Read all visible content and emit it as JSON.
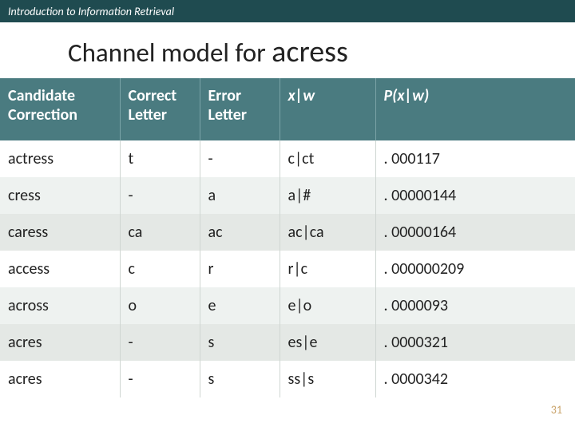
{
  "top_bar": "Introduction to Information Retrieval",
  "title_prefix": "Channel model for ",
  "title_word": "acress",
  "headers": {
    "candidate": "Candidate Correction",
    "correct": "Correct Letter",
    "error": "Error Letter",
    "xw": "x|w",
    "pxw": "P(x|w)"
  },
  "rows": [
    {
      "cand": "actress",
      "correct": "t",
      "error": "-",
      "xw": "c|ct",
      "pxw": ". 000117"
    },
    {
      "cand": "cress",
      "correct": "-",
      "error": "a",
      "xw": "a|#",
      "pxw": ". 00000144"
    },
    {
      "cand": "caress",
      "correct": "ca",
      "error": "ac",
      "xw": "ac|ca",
      "pxw": ". 00000164"
    },
    {
      "cand": "access",
      "correct": "c",
      "error": "r",
      "xw": "r|c",
      "pxw": ". 000000209"
    },
    {
      "cand": "across",
      "correct": "o",
      "error": "e",
      "xw": "e|o",
      "pxw": ". 0000093"
    },
    {
      "cand": "acres",
      "correct": "-",
      "error": "s",
      "xw": "es|e",
      "pxw": ". 0000321"
    },
    {
      "cand": "acres",
      "correct": "-",
      "error": "s",
      "xw": "ss|s",
      "pxw": ". 0000342"
    }
  ],
  "row_shades": [
    "white",
    "light",
    "gray",
    "white",
    "light",
    "gray",
    "white"
  ],
  "page_number": "31",
  "chart_data": {
    "type": "table",
    "title": "Channel model for acress",
    "columns": [
      "Candidate Correction",
      "Correct Letter",
      "Error Letter",
      "x|w",
      "P(x|w)"
    ],
    "rows": [
      [
        "actress",
        "t",
        "-",
        "c|ct",
        0.000117
      ],
      [
        "cress",
        "-",
        "a",
        "a|#",
        1.44e-06
      ],
      [
        "caress",
        "ca",
        "ac",
        "ac|ca",
        1.64e-06
      ],
      [
        "access",
        "c",
        "r",
        "r|c",
        2.09e-07
      ],
      [
        "across",
        "o",
        "e",
        "e|o",
        9.3e-06
      ],
      [
        "acres",
        "-",
        "s",
        "es|e",
        3.21e-05
      ],
      [
        "acres",
        "-",
        "s",
        "ss|s",
        3.42e-05
      ]
    ]
  }
}
